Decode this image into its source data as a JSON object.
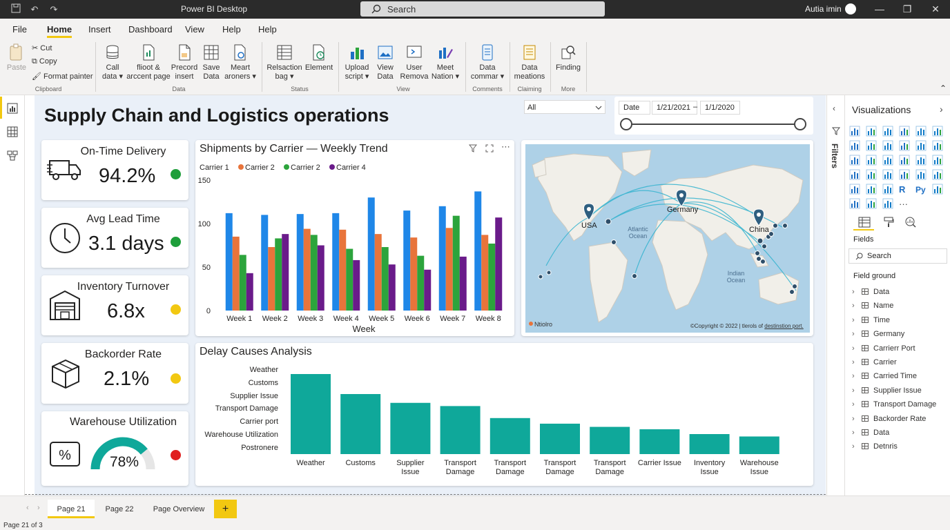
{
  "titlebar": {
    "app_title": "Power BI Desktop",
    "search_placeholder": "Search",
    "user": "Autia imin"
  },
  "menu": [
    "File",
    "Home",
    "Insert",
    "Dashboard",
    "View",
    "Help",
    "Help"
  ],
  "menu_active": "Home",
  "ribbon": {
    "clipboard": {
      "paste": "Paste",
      "cut": "Cut",
      "copy": "Copy",
      "format_painter": "Format painter",
      "group": "Clipboard"
    },
    "data_group": {
      "group": "Data",
      "buttons": [
        {
          "line1": "Call",
          "line2": "data ▾"
        },
        {
          "line1": "flioot &",
          "line2": "arccent page"
        },
        {
          "line1": "Precord",
          "line2": "insert"
        },
        {
          "line1": "Save",
          "line2": "Data"
        },
        {
          "line1": "Meart",
          "line2": "aroners ▾"
        }
      ]
    },
    "status_group": {
      "group": "Status",
      "buttons": [
        {
          "line1": "Relsaction",
          "line2": "bag ▾"
        },
        {
          "line1": "Element",
          "line2": ""
        }
      ]
    },
    "view_group": {
      "group": "View",
      "buttons": [
        {
          "line1": "Upload",
          "line2": "script ▾"
        },
        {
          "line1": "View",
          "line2": "Data"
        },
        {
          "line1": "User",
          "line2": "Remova"
        },
        {
          "line1": "Meet",
          "line2": "Nation ▾"
        }
      ]
    },
    "comments_group": {
      "group": "Comments",
      "buttons": [
        {
          "line1": "Data",
          "line2": "commar ▾"
        }
      ]
    },
    "claiming_group": {
      "group": "Claiming",
      "buttons": [
        {
          "line1": "Data",
          "line2": "meations"
        }
      ]
    },
    "more_group": {
      "group": "More",
      "buttons": [
        {
          "line1": "Finding",
          "line2": ""
        }
      ]
    }
  },
  "report": {
    "title": "Supply Chain and Logistics operations",
    "slicer_value": "All",
    "date_slicer": {
      "label": "Date",
      "from": "1/21/2021",
      "dash": "–",
      "to": "1/1/2020"
    }
  },
  "kpis": [
    {
      "title": "On-Time Delivery",
      "value": "94.2%",
      "status_color": "#1e9e3a",
      "icon": "truck-icon"
    },
    {
      "title": "Avg Lead Time",
      "value": "3.1 days",
      "status_color": "#1e9e3a",
      "icon": "clock-icon"
    },
    {
      "title": "Inventory Turnover",
      "value": "6.8x",
      "status_color": "#f2c811",
      "icon": "warehouse-icon"
    },
    {
      "title": "Backorder Rate",
      "value": "2.1%",
      "status_color": "#f2c811",
      "icon": "box-icon"
    },
    {
      "title": "Warehouse Utilization",
      "value": "78%",
      "status_color": "#e01e1e",
      "icon": "percent-icon",
      "gauge_fraction": 0.78
    }
  ],
  "shipments_chart": {
    "title": "Shipments by Carrier — Weekly Trend",
    "chart_data": {
      "type": "bar",
      "categories": [
        "Week 1",
        "Week 2",
        "Week 3",
        "Week 4",
        "Week 5",
        "Week 6",
        "Week 7",
        "Week 8"
      ],
      "series": [
        {
          "name": "Carrier 1",
          "color": "#1f87e8",
          "values": [
            112,
            110,
            111,
            112,
            130,
            115,
            120,
            137
          ]
        },
        {
          "name": "Carrier 2",
          "color": "#e8743b",
          "values": [
            85,
            73,
            94,
            93,
            88,
            84,
            95,
            87
          ]
        },
        {
          "name": "Carrier 2",
          "color": "#2ca43c",
          "values": [
            64,
            83,
            87,
            71,
            73,
            63,
            109,
            77
          ]
        },
        {
          "name": "Carrier 4",
          "color": "#6a1b8a",
          "values": [
            43,
            88,
            75,
            58,
            53,
            47,
            62,
            107
          ]
        }
      ],
      "xlabel": "Week",
      "ylabel": "",
      "ylim": [
        0,
        150
      ],
      "yticks": [
        0,
        50,
        100,
        150
      ],
      "legend": "top-left"
    }
  },
  "map": {
    "labels": {
      "usa": "USA",
      "germany": "Germany",
      "china": "China",
      "atlantic": "Atlantic Ocean",
      "indian": "Indian Ocean"
    },
    "footer_left": "Ntiolro",
    "footer_right": "©Copyright © 2022 | tlerols of",
    "footer_link": "destinstion port."
  },
  "delay_chart": {
    "title": "Delay Causes Analysis",
    "legend_items": [
      "Weather",
      "Customs",
      "Supplier Issue",
      "Transport Damage",
      "Carrier port",
      "Warehouse Utilization",
      "Postronere"
    ],
    "chart_data": {
      "type": "bar",
      "categories": [
        "Weather",
        "Customs",
        "Supplier Issue",
        "Transport Damage",
        "Transport Damage",
        "Transport Damage",
        "Transport Damage",
        "Carrier Issue",
        "Inventory Issue",
        "Warehouse Issue"
      ],
      "values": [
        100,
        75,
        64,
        60,
        45,
        38,
        34,
        31,
        25,
        22
      ],
      "color": "#0fa89a",
      "ylim": [
        0,
        100
      ]
    }
  },
  "visualizations": {
    "title": "Visualizations",
    "filters_label": "Filters"
  },
  "fields": {
    "label": "Fields",
    "search_placeholder": "Search",
    "group": "Field ground",
    "items": [
      "Data",
      "Name",
      "Time",
      "Germany",
      "Carrierr Port",
      "Carrier",
      "Carried Time",
      "Supplier Issue",
      "Transport Damage",
      "Backorder Rate",
      "Data",
      "Detnris"
    ]
  },
  "pages": {
    "tabs": [
      "Page 21",
      "Page 22",
      "Page Overview"
    ],
    "active": "Page 21",
    "add": "+"
  },
  "status": {
    "text": "Page 21 of 3"
  }
}
